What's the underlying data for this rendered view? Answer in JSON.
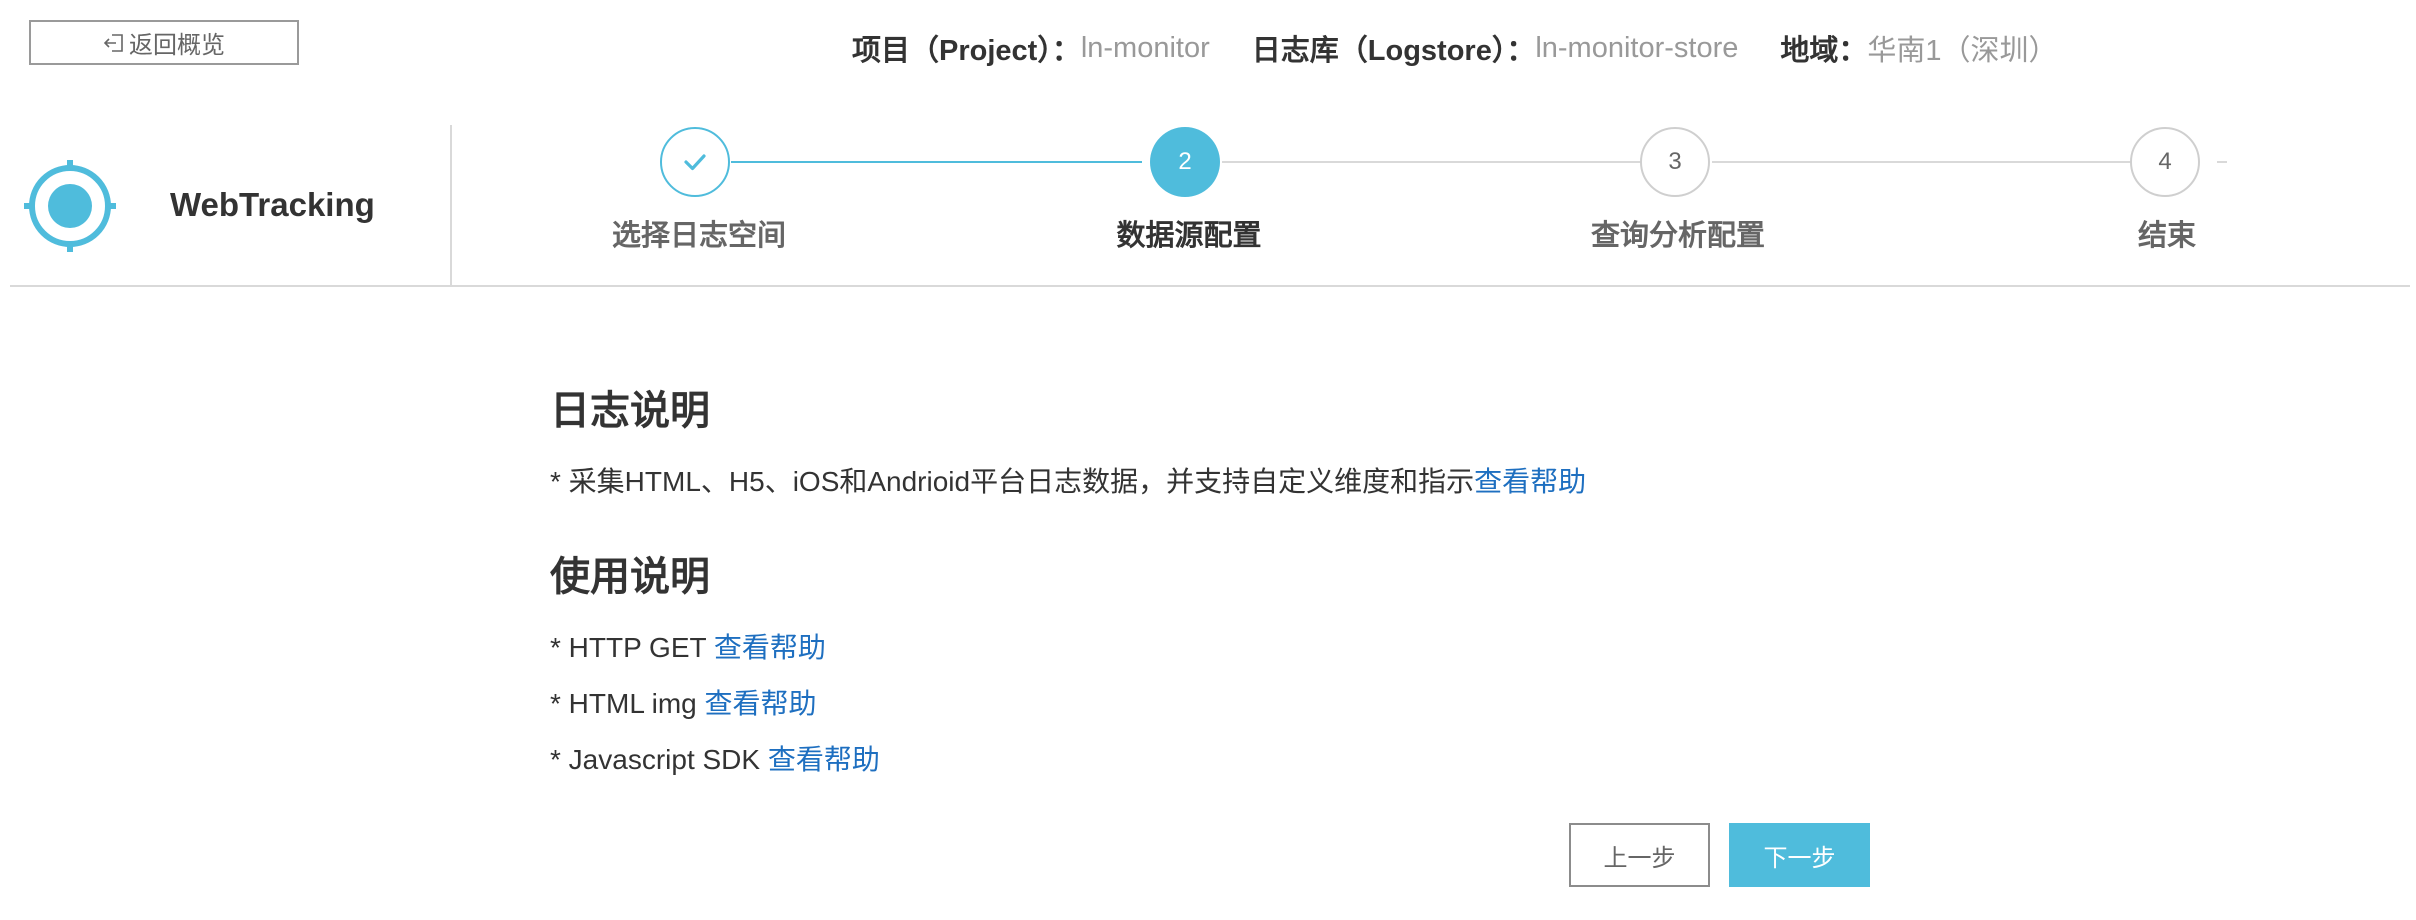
{
  "header": {
    "back_label": "返回概览",
    "project_label": "项目（Project）：",
    "project_value": "ln-monitor",
    "logstore_label": "日志库（Logstore）：",
    "logstore_value": "ln-monitor-store",
    "region_label": "地域：",
    "region_value": "华南1（深圳）"
  },
  "product": {
    "name": "WebTracking",
    "icon": "target-icon"
  },
  "steps": [
    {
      "number": "1",
      "label": "选择日志空间",
      "status": "done"
    },
    {
      "number": "2",
      "label": "数据源配置",
      "status": "active"
    },
    {
      "number": "3",
      "label": "查询分析配置",
      "status": "todo"
    },
    {
      "number": "4",
      "label": "结束",
      "status": "todo"
    }
  ],
  "content": {
    "log_title": "日志说明",
    "log_desc": "* 采集HTML、H5、iOS和Andrioid平台日志数据，并支持自定义维度和指示",
    "log_link": "查看帮助",
    "usage_title": "使用说明",
    "usage_items": [
      {
        "text": "* HTTP GET ",
        "link": "查看帮助"
      },
      {
        "text": "* HTML img ",
        "link": "查看帮助"
      },
      {
        "text": "* Javascript SDK ",
        "link": "查看帮助"
      }
    ]
  },
  "buttons": {
    "prev_label": "上一步",
    "next_label": "下一步"
  },
  "colors": {
    "accent": "#4fbcdc",
    "link": "#1e6fc0",
    "border": "#d9d9d9"
  }
}
